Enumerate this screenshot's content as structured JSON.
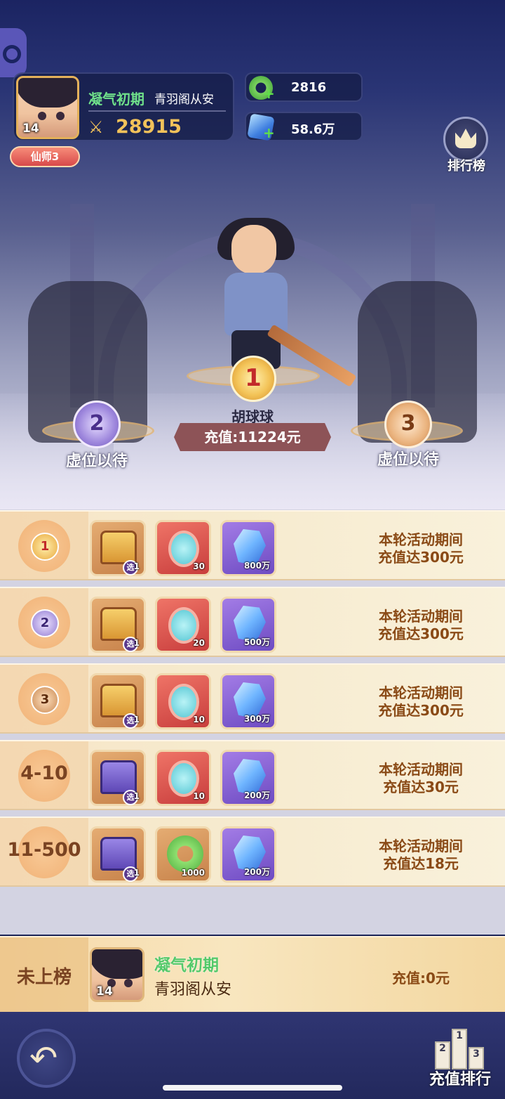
{
  "profile": {
    "level": "14",
    "realm": "凝气初期",
    "name": "青羽阁从安",
    "power": "28915",
    "title_badge": "仙师3"
  },
  "currencies": [
    {
      "icon": "jade-ring-icon",
      "value": "2816"
    },
    {
      "icon": "crystal-icon",
      "value": "58.6万"
    }
  ],
  "ranking_button": {
    "icon": "crown-icon",
    "label": "排行榜"
  },
  "podium": {
    "first": {
      "rank": "1",
      "name": "胡球球",
      "amount": "充值:11224元"
    },
    "second": {
      "rank": "2",
      "label": "虚位以待"
    },
    "third": {
      "rank": "3",
      "label": "虚位以待"
    }
  },
  "rewards": [
    {
      "rank": "1",
      "items": [
        {
          "icon": "chest-icon",
          "qty": "1",
          "select": "选"
        },
        {
          "icon": "mirror-icon",
          "qty": "30"
        },
        {
          "icon": "crystal-icon",
          "qty": "800万"
        }
      ],
      "condition_line1": "本轮活动期间",
      "condition_line2": "充值达300元"
    },
    {
      "rank": "2",
      "items": [
        {
          "icon": "chest-icon",
          "qty": "1",
          "select": "选"
        },
        {
          "icon": "mirror-icon",
          "qty": "20"
        },
        {
          "icon": "crystal-icon",
          "qty": "500万"
        }
      ],
      "condition_line1": "本轮活动期间",
      "condition_line2": "充值达300元"
    },
    {
      "rank": "3",
      "items": [
        {
          "icon": "chest-icon",
          "qty": "1",
          "select": "选"
        },
        {
          "icon": "mirror-icon",
          "qty": "10"
        },
        {
          "icon": "crystal-icon",
          "qty": "300万"
        }
      ],
      "condition_line1": "本轮活动期间",
      "condition_line2": "充值达300元"
    },
    {
      "rank": "4-10",
      "items": [
        {
          "icon": "chest-icon",
          "qty": "1",
          "select": "选"
        },
        {
          "icon": "mirror-icon",
          "qty": "10"
        },
        {
          "icon": "crystal-icon",
          "qty": "200万"
        }
      ],
      "condition_line1": "本轮活动期间",
      "condition_line2": "充值达30元"
    },
    {
      "rank": "11-500",
      "items": [
        {
          "icon": "chest-icon",
          "qty": "1",
          "select": "选"
        },
        {
          "icon": "jade-ring-icon",
          "qty": "1000"
        },
        {
          "icon": "crystal-icon",
          "qty": "200万"
        }
      ],
      "condition_line1": "本轮活动期间",
      "condition_line2": "充值达18元"
    }
  ],
  "my_rank": {
    "rank_text": "未上榜",
    "level": "14",
    "realm": "凝气初期",
    "name": "青羽阁从安",
    "charge": "充值:0元"
  },
  "bottom_nav": {
    "back_icon": "back-arrow-icon",
    "charge_rank_label": "充值排行",
    "podium_numbers": [
      "2",
      "1",
      "3"
    ]
  }
}
